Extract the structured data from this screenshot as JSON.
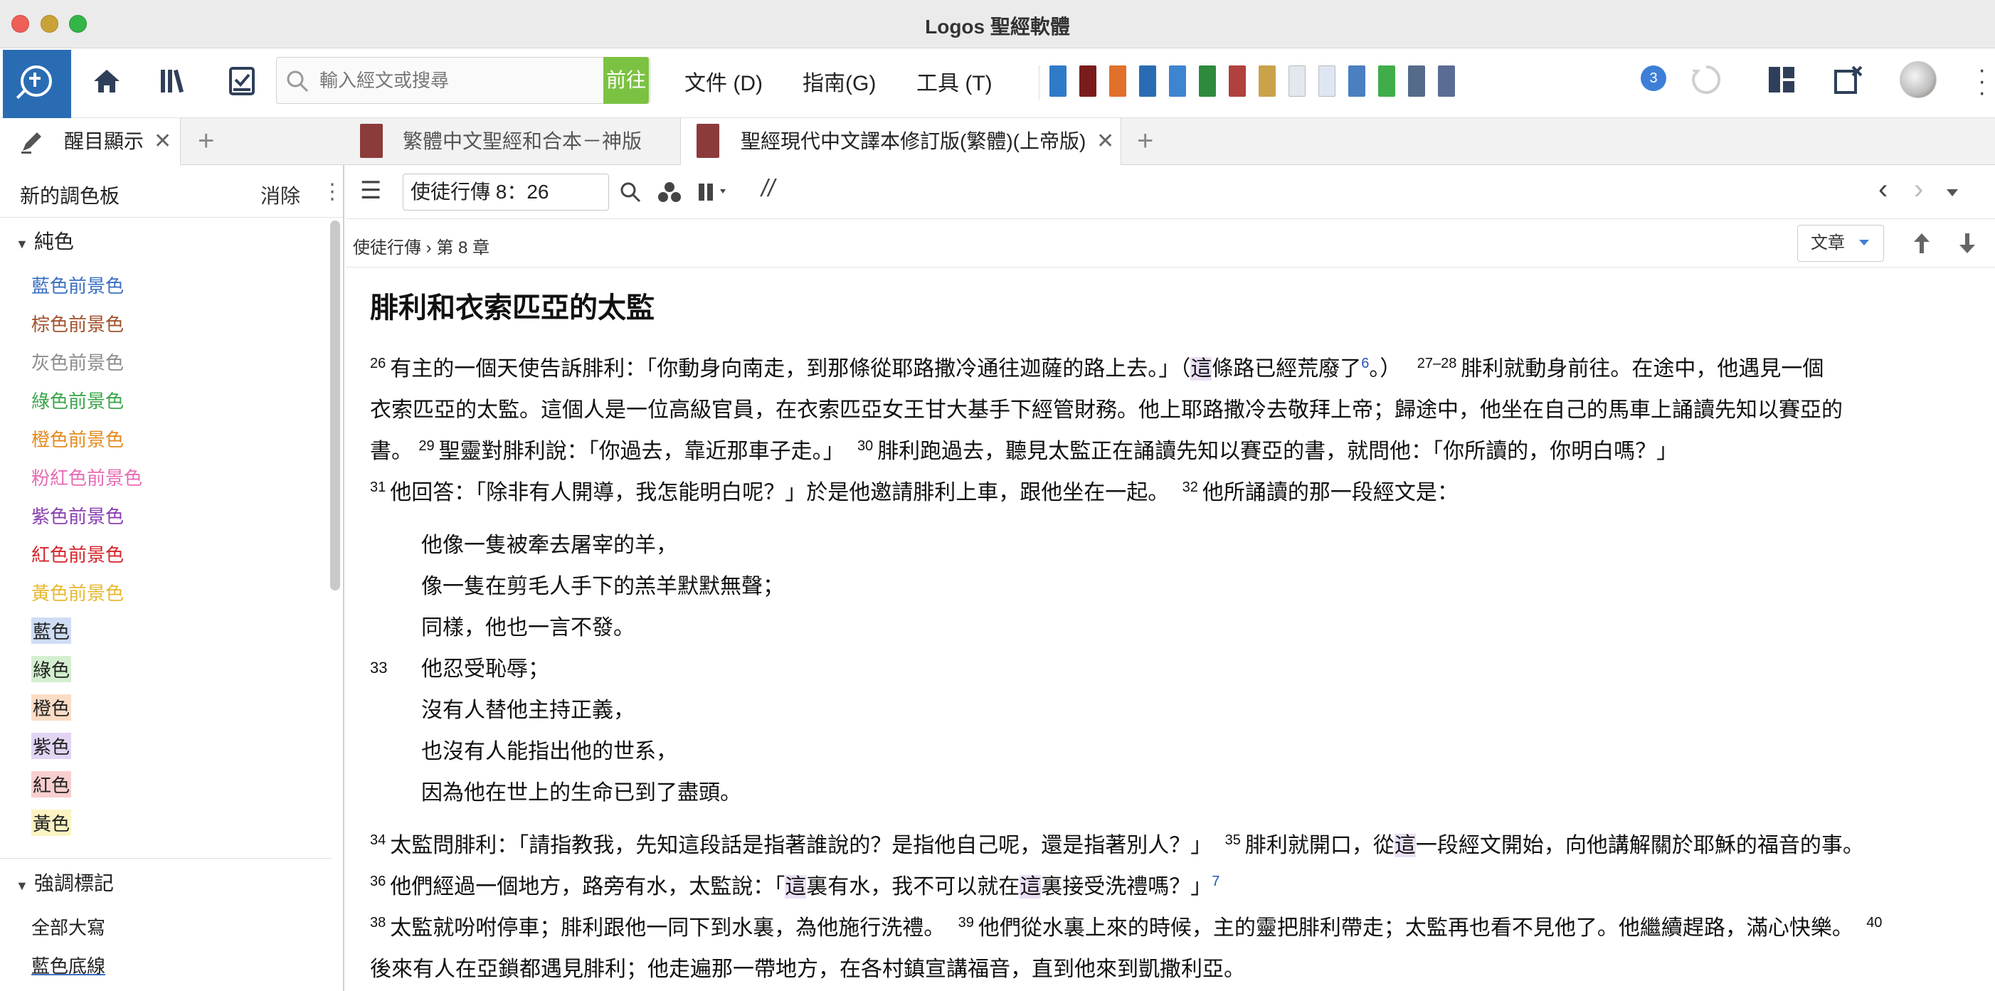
{
  "window": {
    "title": "Logos 聖經軟體"
  },
  "toolbar": {
    "search_placeholder": "輸入經文或搜尋",
    "go_label": "前往",
    "menu": [
      "文件 (D)",
      "指南(G)",
      "工具 (T)"
    ],
    "notification_count": "3"
  },
  "tabs": {
    "left_tab": "醒目顯示",
    "doc_tabs": [
      "繁體中文聖經和合本－神版",
      "聖經現代中文譯本修訂版(繁體)(上帝版)"
    ]
  },
  "palette": {
    "title": "新的調色板",
    "clear_label": "消除",
    "section_solid": "純色",
    "solid_items": [
      {
        "label": "藍色前景色",
        "color": "#3a6fbf"
      },
      {
        "label": "棕色前景色",
        "color": "#a0522d"
      },
      {
        "label": "灰色前景色",
        "color": "#8c8c8c"
      },
      {
        "label": "綠色前景色",
        "color": "#3aa64a"
      },
      {
        "label": "橙色前景色",
        "color": "#e58a1f"
      },
      {
        "label": "粉紅色前景色",
        "color": "#e86bb5"
      },
      {
        "label": "紫色前景色",
        "color": "#8a3fb0"
      },
      {
        "label": "紅色前景色",
        "color": "#d6242a"
      },
      {
        "label": "黃色前景色",
        "color": "#e8b830"
      }
    ],
    "bg_items": [
      {
        "label": "藍色",
        "color": "#cfdcf5"
      },
      {
        "label": "綠色",
        "color": "#d3efcf"
      },
      {
        "label": "橙色",
        "color": "#fbdcc4"
      },
      {
        "label": "紫色",
        "color": "#e2d4f3"
      },
      {
        "label": "紅色",
        "color": "#f8cfcf"
      },
      {
        "label": "黃色",
        "color": "#fbf3c2"
      }
    ],
    "section_emphasis": "強調標記",
    "emphasis_items": [
      "全部大寫",
      "藍色底線"
    ]
  },
  "reader": {
    "reference": "使徒行傳 8：26",
    "breadcrumb_book": "使徒行傳",
    "breadcrumb_chapter": "第 8 章",
    "view_label": "文章",
    "heading": "腓利和衣索匹亞的太監",
    "verses": {
      "v26_num": "26",
      "v26_a": "有主的一個天使告訴腓利：「你動身向南走，到那條從耶路撒冷通往迦薩的路上去。」（",
      "v26_mark": "這",
      "v26_b": "條路已經荒廢了",
      "v26_fn": "6",
      "v26_c": "。）",
      "v27_num": "27–28",
      "v27_a": "腓利就動身前往。在途中，他遇見一個",
      "line2": "衣索匹亞的太監。這個人是一位高級官員，在衣索匹亞女王甘大基手下經管財務。他上耶路撒冷去敬拜上帝；歸途中，他坐在自己的馬車上誦讀先知以賽亞的",
      "line3_a": "書。",
      "v29_num": "29",
      "v29": "聖靈對腓利說：「你過去，靠近那車子走。」",
      "v30_num": "30",
      "v30": "腓利跑過去，聽見太監正在誦讀先知以賽亞的書，就問他：「你所讀的，你明白嗎？」",
      "v31_num": "31",
      "v31": "他回答：「除非有人開導，我怎能明白呢？」於是他邀請腓利上車，跟他坐在一起。",
      "v32_num": "32",
      "v32": "他所誦讀的那一段經文是：",
      "poem": [
        "他像一隻被牽去屠宰的羊，",
        "像一隻在剪毛人手下的羔羊默默無聲；",
        "同樣，他也一言不發。",
        "他忍受恥辱；",
        "沒有人替他主持正義，",
        "也沒有人能指出他的世系，",
        "因為他在世上的生命已到了盡頭。"
      ],
      "v33_num": "33",
      "v34_num": "34",
      "v34": "太監問腓利：「請指教我，先知這段話是指著誰說的？是指他自己呢，還是指著別人？」",
      "v35_num": "35",
      "v35_a": "腓利就開口，從",
      "v35_mark": "這",
      "v35_b": "一段經文開始，向他講解關於耶穌的福音的事。",
      "v36_num": "36",
      "v36_a": "他們經過一個地方，路旁有水，太監說：「",
      "v36_mark1": "這",
      "v36_b": "裏有水，我不可以就在",
      "v36_mark2": "這",
      "v36_c": "裏接受洗禮嗎？」",
      "v36_fn": "7",
      "v38_num": "38",
      "v38": "太監就吩咐停車；腓利跟他一同下到水裏，為他施行洗禮。",
      "v39_num": "39",
      "v39": "他們從水裏上來的時候，主的靈把腓利帶走；太監再也看不見他了。他繼續趕路，滿心快樂。",
      "v40_num": "40",
      "v40": "後來有人在亞鎖都遇見腓利；他走遍那一帶地方，在各村鎮宣講福音，直到他來到凱撒利亞。"
    }
  }
}
